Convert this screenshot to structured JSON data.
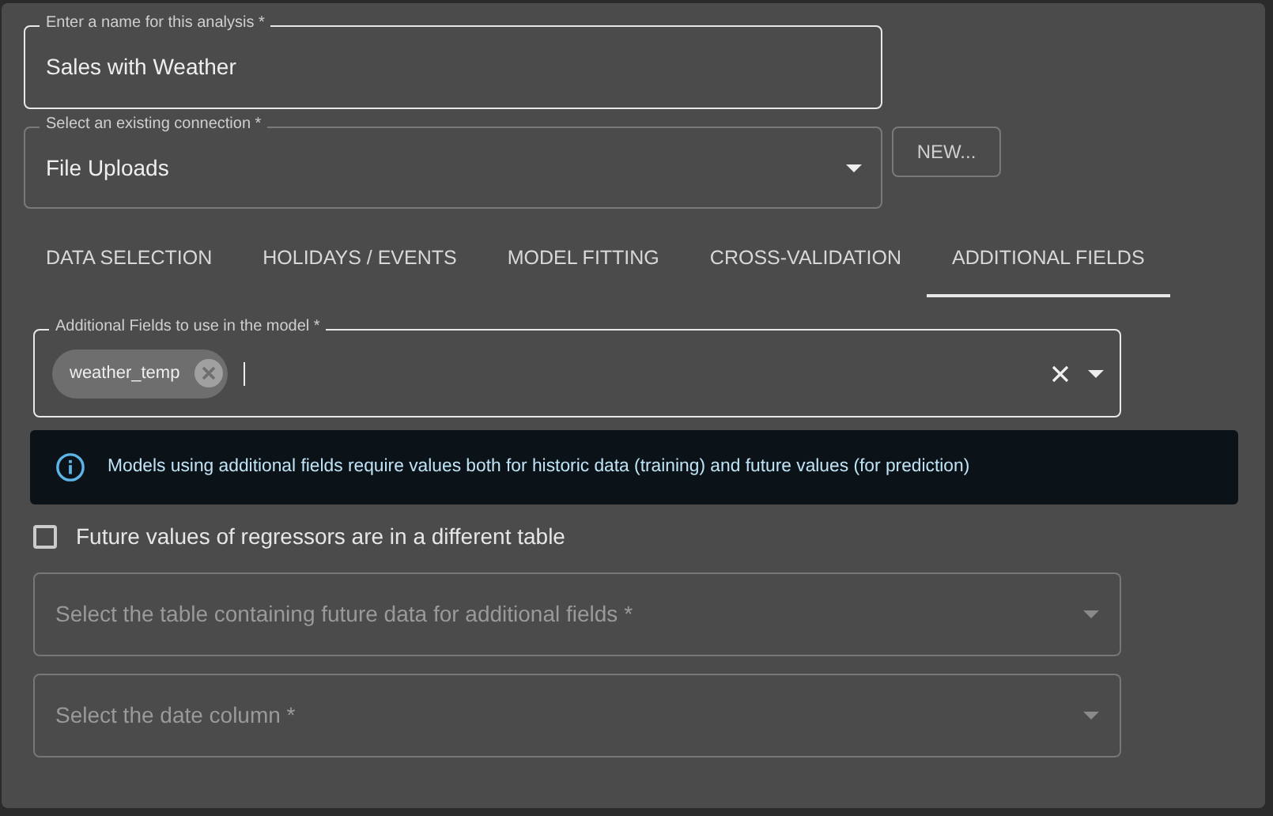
{
  "name_field": {
    "label": "Enter a name for this analysis *",
    "value": "Sales with Weather",
    "focused": true
  },
  "connection": {
    "label": "Select an existing connection *",
    "value": "File Uploads",
    "focused": false
  },
  "new_button": "NEW...",
  "tabs": [
    {
      "label": "DATA SELECTION",
      "selected": false
    },
    {
      "label": "HOLIDAYS / EVENTS",
      "selected": false
    },
    {
      "label": "MODEL FITTING",
      "selected": false
    },
    {
      "label": "CROSS-VALIDATION",
      "selected": false
    },
    {
      "label": "ADDITIONAL FIELDS",
      "selected": true
    }
  ],
  "additional_fields": {
    "label": "Additional Fields to use in the model *",
    "chips": [
      "weather_temp"
    ],
    "focused": true
  },
  "info": "Models using additional fields require values both for historic data (training) and future values (for prediction)",
  "future_checkbox": {
    "label": "Future values of regressors are in a different table",
    "checked": false
  },
  "selects": [
    {
      "placeholder": "Select the table containing future data for additional fields *"
    },
    {
      "placeholder": "Select the date column *"
    }
  ]
}
